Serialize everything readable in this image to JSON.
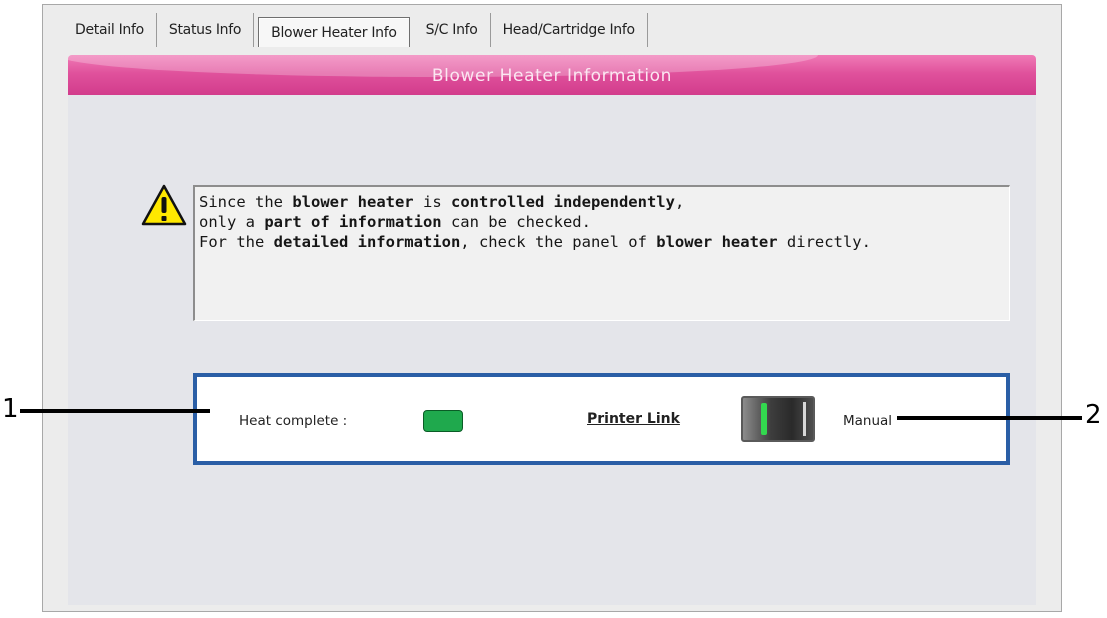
{
  "tabs": [
    {
      "label": "Detail Info"
    },
    {
      "label": "Status Info"
    },
    {
      "label": "Blower Heater Info",
      "active": true
    },
    {
      "label": "S/C Info"
    },
    {
      "label": "Head/Cartridge Info"
    }
  ],
  "header": {
    "title": "Blower Heater Information",
    "color": "#E0529C"
  },
  "message": {
    "icon": "warning-icon",
    "lines": [
      "Since the blower heater is controlled independently,",
      "only a part of information can be checked.",
      "For the detailed information, check the panel of blower heater directly."
    ]
  },
  "status": {
    "heat_complete_label": "Heat complete :",
    "heat_indicator_color": "#1FA94D",
    "printer_link_label": "Printer Link",
    "toggle_state": "printer-link",
    "manual_label": "Manual",
    "panel_border_color": "#2A5EA6"
  },
  "callouts": {
    "left": "1",
    "right": "2"
  }
}
